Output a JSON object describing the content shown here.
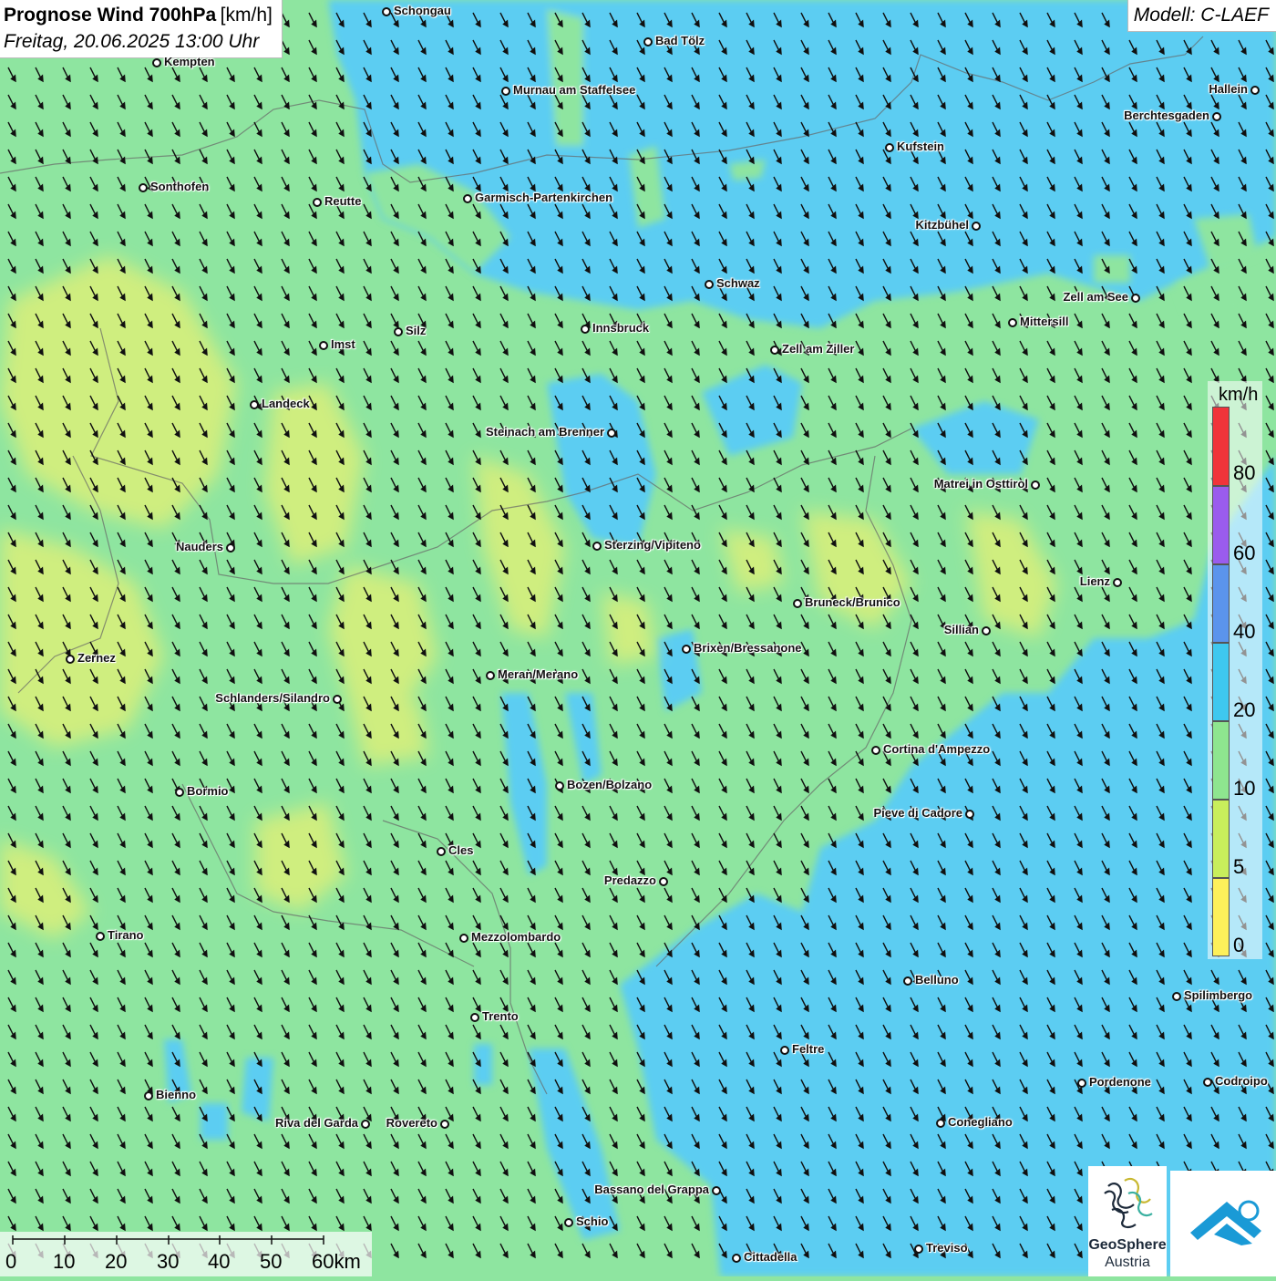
{
  "header": {
    "title": "Prognose Wind 700hPa",
    "unit": "[km/h]",
    "datetime": "Freitag, 20.06.2025 13:00 Uhr"
  },
  "model_label": "Modell: C-LAEF",
  "legend": {
    "unit": "km/h",
    "labels": [
      "80",
      "60",
      "40",
      "20",
      "10",
      "5",
      "0"
    ],
    "classes": [
      {
        "color": "#fdf05a"
      },
      {
        "color": "#c8ee5c"
      },
      {
        "color": "#8ee58f"
      },
      {
        "color": "#3ec8ef"
      },
      {
        "color": "#5b94ec"
      },
      {
        "color": "#9a5ced"
      },
      {
        "color": "#f0343a"
      }
    ]
  },
  "wind_direction_arrow": "south-southeast",
  "cities": [
    {
      "name": "Schongau"
    },
    {
      "name": "Bad Tölz"
    },
    {
      "name": "Kempten"
    },
    {
      "name": "Murnau am Staffelsee"
    },
    {
      "name": "Hallein"
    },
    {
      "name": "Berchtesgaden"
    },
    {
      "name": "Kufstein"
    },
    {
      "name": "Sonthofen"
    },
    {
      "name": "Reutte"
    },
    {
      "name": "Garmisch-Partenkirchen"
    },
    {
      "name": "Kitzbühel"
    },
    {
      "name": "Schwaz"
    },
    {
      "name": "Zell am See"
    },
    {
      "name": "Innsbruck"
    },
    {
      "name": "Mittersill"
    },
    {
      "name": "Silz"
    },
    {
      "name": "Imst"
    },
    {
      "name": "Zell am Ziller"
    },
    {
      "name": "Landeck"
    },
    {
      "name": "Steinach am Brenner"
    },
    {
      "name": "Matrei in Osttirol"
    },
    {
      "name": "Nauders"
    },
    {
      "name": "Sterzing/Vipiteno"
    },
    {
      "name": "Lienz"
    },
    {
      "name": "Bruneck/Brunico"
    },
    {
      "name": "Sillian"
    },
    {
      "name": "Brixen/Bressanone"
    },
    {
      "name": "Zernez"
    },
    {
      "name": "Meran/Merano"
    },
    {
      "name": "Schlanders/Silandro"
    },
    {
      "name": "Cortina d'Ampezzo"
    },
    {
      "name": "Bozen/Bolzano"
    },
    {
      "name": "Bormio"
    },
    {
      "name": "Pieve di Cadore"
    },
    {
      "name": "Cles"
    },
    {
      "name": "Predazzo"
    },
    {
      "name": "Tirano"
    },
    {
      "name": "Mezzolombardo"
    },
    {
      "name": "Belluno"
    },
    {
      "name": "Spilimbergo"
    },
    {
      "name": "Trento"
    },
    {
      "name": "Feltre"
    },
    {
      "name": "Pordenone"
    },
    {
      "name": "Codroipo"
    },
    {
      "name": "Bienno"
    },
    {
      "name": "Riva del Garda"
    },
    {
      "name": "Rovereto"
    },
    {
      "name": "Conegliano"
    },
    {
      "name": "Bassano del Grappa"
    },
    {
      "name": "Schio"
    },
    {
      "name": "Treviso"
    },
    {
      "name": "Cittadella"
    }
  ],
  "scalebar": {
    "labels": [
      "0",
      "10",
      "20",
      "30",
      "40",
      "50",
      "60km"
    ]
  },
  "logos": {
    "geosphere_line1": "GeoSphere",
    "geosphere_line2": "Austria"
  }
}
